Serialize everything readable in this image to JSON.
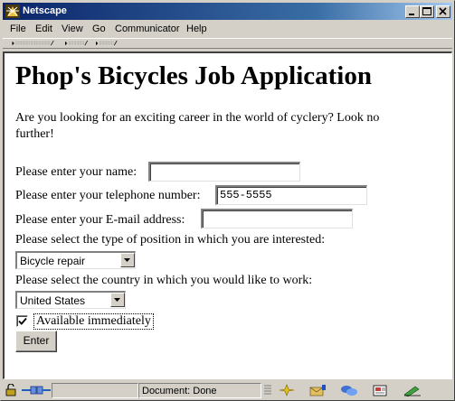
{
  "window": {
    "title": "Netscape",
    "controls": [
      "minimize-icon",
      "maximize-icon",
      "close-icon"
    ]
  },
  "menu": {
    "items": [
      {
        "label": "File"
      },
      {
        "label": "Edit"
      },
      {
        "label": "View"
      },
      {
        "label": "Go"
      },
      {
        "label": "Communicator"
      },
      {
        "label": "Help"
      }
    ]
  },
  "page": {
    "heading": "Phop's Bicycles Job Application",
    "intro": "Are you looking for an exciting career in the world of cyclery? Look no further!",
    "form": {
      "name_label": "Please enter your name:",
      "name_value": "",
      "phone_label": "Please enter your telephone number:",
      "phone_value": "555-5555",
      "email_label": "Please enter your E-mail address:",
      "email_value": "",
      "position_label": "Please select the type of position in which you are interested:",
      "position_selected": "Bicycle repair",
      "country_label": "Please select the country in which you would like to work:",
      "country_selected": "United States",
      "available_label": "Available immediately",
      "available_checked": true,
      "submit_label": "Enter"
    }
  },
  "status": {
    "text": "Document: Done",
    "icons": [
      "security-lock-icon",
      "online-plug-icon",
      "component-bar-navigator-icon",
      "mail-icon",
      "discussion-icon",
      "composer-icon",
      "address-book-icon"
    ]
  }
}
